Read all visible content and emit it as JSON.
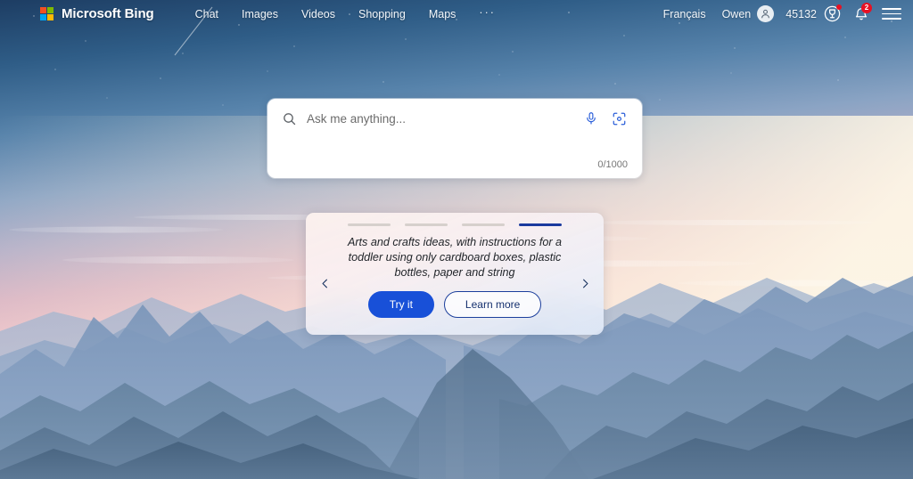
{
  "header": {
    "brand": "Microsoft Bing",
    "logo_icon": "microsoft-squares-icon",
    "nav": [
      {
        "label": "Chat"
      },
      {
        "label": "Images"
      },
      {
        "label": "Videos"
      },
      {
        "label": "Shopping"
      },
      {
        "label": "Maps"
      },
      {
        "label": "···"
      }
    ],
    "language": "Français",
    "username": "Owen",
    "avatar_icon": "person-avatar-icon",
    "rewards_points": "45132",
    "rewards_icon": "trophy-icon",
    "notifications_icon": "bell-icon",
    "notifications_count": "2",
    "menu_icon": "hamburger-menu-icon"
  },
  "search": {
    "search_icon": "search-icon",
    "placeholder": "Ask me anything...",
    "value": "",
    "mic_icon": "microphone-icon",
    "visual_search_icon": "visual-search-camera-icon",
    "counter": "0/1000"
  },
  "carousel": {
    "indicator_count": 4,
    "active_index": 3,
    "prev_icon": "chevron-left-icon",
    "next_icon": "chevron-right-icon",
    "prompt": "Arts and crafts ideas, with instructions for a toddler using only cardboard boxes, plastic bottles, paper and string",
    "try_label": "Try it",
    "learn_label": "Learn more"
  },
  "colors": {
    "accent_blue": "#1850d8",
    "active_bar": "#1a3a9e",
    "badge_red": "#e81123",
    "ms_red": "#f25022",
    "ms_green": "#7fba00",
    "ms_blue": "#00a4ef",
    "ms_yellow": "#ffb900"
  }
}
